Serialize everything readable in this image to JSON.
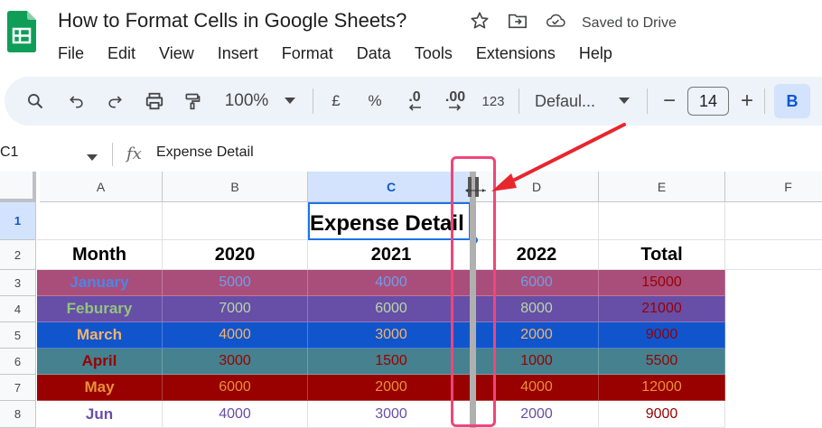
{
  "app": {
    "doc_title": "How to Format Cells in Google Sheets?",
    "saved_status": "Saved to Drive",
    "menu": [
      "File",
      "Edit",
      "View",
      "Insert",
      "Format",
      "Data",
      "Tools",
      "Extensions",
      "Help"
    ]
  },
  "toolbar": {
    "zoom": "100%",
    "currency": "£",
    "percent": "%",
    "dec_decrease": ".0",
    "dec_increase": ".00",
    "number_format": "123",
    "font": "Defaul...",
    "font_size_minus": "−",
    "font_size": "14",
    "font_size_plus": "+",
    "bold": "B"
  },
  "formula_bar": {
    "name_box": "C1",
    "fx": "fx",
    "content": "Expense Detail"
  },
  "sheet": {
    "columns": [
      "A",
      "B",
      "C",
      "D",
      "E",
      "F"
    ],
    "selected_column": "C",
    "rows": [
      "1",
      "2",
      "3",
      "4",
      "5",
      "6",
      "7",
      "8"
    ],
    "selected_row": "1",
    "title": "Expense Detail",
    "header": [
      "Month",
      "2020",
      "2021",
      "2022",
      "Total"
    ],
    "data": [
      {
        "month": "January",
        "v2020": "5000",
        "v2021": "4000",
        "v2022": "6000",
        "total": "15000",
        "bg": "#a94e7b",
        "month_color": "#4a86e8",
        "val_color": "#6d9eeb",
        "total_color": "#990000"
      },
      {
        "month": "Feburary",
        "v2020": "7000",
        "v2021": "6000",
        "v2022": "8000",
        "total": "21000",
        "bg": "#674ea7",
        "month_color": "#93c47d",
        "val_color": "#b6d7a8",
        "total_color": "#990000"
      },
      {
        "month": "March",
        "v2020": "4000",
        "v2021": "3000",
        "v2022": "2000",
        "total": "9000",
        "bg": "#1155cc",
        "month_color": "#f6b26b",
        "val_color": "#f6b26b",
        "total_color": "#990000"
      },
      {
        "month": "April",
        "v2020": "3000",
        "v2021": "1500",
        "v2022": "1000",
        "total": "5500",
        "bg": "#45818e",
        "month_color": "#990000",
        "val_color": "#990000",
        "total_color": "#990000"
      },
      {
        "month": "May",
        "v2020": "6000",
        "v2021": "2000",
        "v2022": "4000",
        "total": "12000",
        "bg": "#990000",
        "month_color": "#e69138",
        "val_color": "#e69138",
        "total_color": "#e69138"
      },
      {
        "month": "Jun",
        "v2020": "4000",
        "v2021": "3000",
        "v2022": "2000",
        "total": "9000",
        "bg": "#ffffff",
        "month_color": "#674ea7",
        "val_color": "#674ea7",
        "total_color": "#990000"
      }
    ]
  },
  "colors": {
    "accent": "#1a73e8",
    "highlight": "#f0457a",
    "arrow": "#e8262d"
  }
}
